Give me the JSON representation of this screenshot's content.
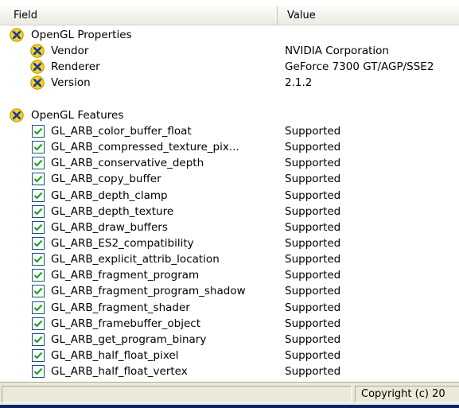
{
  "columns": {
    "field": "Field",
    "value": "Value"
  },
  "groups": [
    {
      "title": "OpenGL Properties",
      "icon": "opengl-x-icon",
      "items": [
        {
          "field": "Vendor",
          "value": "NVIDIA Corporation"
        },
        {
          "field": "Renderer",
          "value": "GeForce 7300 GT/AGP/SSE2"
        },
        {
          "field": "Version",
          "value": "2.1.2"
        }
      ]
    },
    {
      "title": "OpenGL Features",
      "icon": "opengl-x-icon",
      "items": [
        {
          "field": "GL_ARB_color_buffer_float",
          "value": "Supported"
        },
        {
          "field": "GL_ARB_compressed_texture_pix...",
          "value": "Supported"
        },
        {
          "field": "GL_ARB_conservative_depth",
          "value": "Supported"
        },
        {
          "field": "GL_ARB_copy_buffer",
          "value": "Supported"
        },
        {
          "field": "GL_ARB_depth_clamp",
          "value": "Supported"
        },
        {
          "field": "GL_ARB_depth_texture",
          "value": "Supported"
        },
        {
          "field": "GL_ARB_draw_buffers",
          "value": "Supported"
        },
        {
          "field": "GL_ARB_ES2_compatibility",
          "value": "Supported"
        },
        {
          "field": "GL_ARB_explicit_attrib_location",
          "value": "Supported"
        },
        {
          "field": "GL_ARB_fragment_program",
          "value": "Supported"
        },
        {
          "field": "GL_ARB_fragment_program_shadow",
          "value": "Supported"
        },
        {
          "field": "GL_ARB_fragment_shader",
          "value": "Supported"
        },
        {
          "field": "GL_ARB_framebuffer_object",
          "value": "Supported"
        },
        {
          "field": "GL_ARB_get_program_binary",
          "value": "Supported"
        },
        {
          "field": "GL_ARB_half_float_pixel",
          "value": "Supported"
        },
        {
          "field": "GL_ARB_half_float_vertex",
          "value": "Supported"
        }
      ]
    }
  ],
  "statusbar": {
    "left_text": "",
    "right_text": "Copyright (c) 20"
  },
  "colors": {
    "header_bg": "#ebeae3",
    "statusbar_bg": "#ece9d8",
    "icon_yellow": "#f5d21a",
    "icon_blue": "#1c3a9c",
    "check_green": "#22a022"
  }
}
